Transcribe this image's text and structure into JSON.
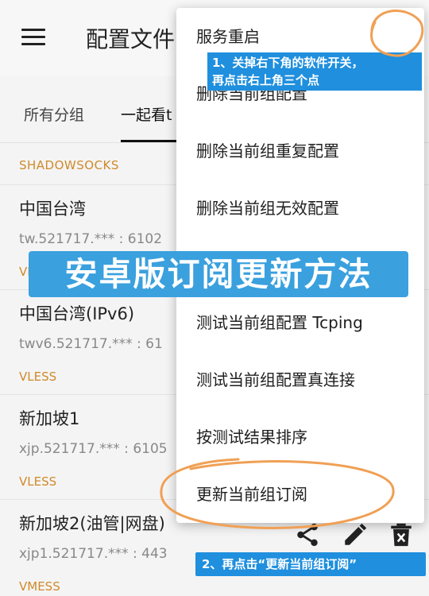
{
  "app_bar": {
    "title": "配置文件"
  },
  "tabs": [
    {
      "label": "所有分组"
    },
    {
      "label": "一起看t"
    }
  ],
  "group_header": "SHADOWSOCKS",
  "servers": [
    {
      "name": "中国台湾",
      "address": "tw.521717.*** : 6102",
      "protocol": "VLESS"
    },
    {
      "name": "中国台湾(IPv6)",
      "address": "twv6.521717.*** : 61",
      "protocol": "VLESS"
    },
    {
      "name": "新加坡1",
      "address": "xjp.521717.*** : 6105",
      "protocol": "VLESS"
    },
    {
      "name": "新加坡2(油管|网盘)",
      "address": "xjp1.521717.*** : 443",
      "protocol": "VMESS"
    }
  ],
  "menu": {
    "items": [
      {
        "label": "服务重启"
      },
      {
        "label": "删除当前组配置"
      },
      {
        "label": "删除当前组重复配置"
      },
      {
        "label": "删除当前组无效配置"
      },
      {
        "label": ""
      },
      {
        "label": "测试当前组配置 Tcping"
      },
      {
        "label": "测试当前组配置真连接"
      },
      {
        "label": "按测试结果排序"
      },
      {
        "label": "更新当前组订阅"
      }
    ]
  },
  "overlays": {
    "banner": "安卓版订阅更新方法",
    "step1_line1": "1、关掉右下角的软件开关，",
    "step1_line2": "再点击右上角三个点",
    "step2": "2、再点击“更新当前组订阅”"
  },
  "icons": [
    "menu-icon",
    "share-icon",
    "edit-icon",
    "delete-icon"
  ],
  "colors": {
    "accent": "#d08a2a",
    "annotation_blue": "#1f8fde",
    "highlight_orange": "#f0a055"
  }
}
